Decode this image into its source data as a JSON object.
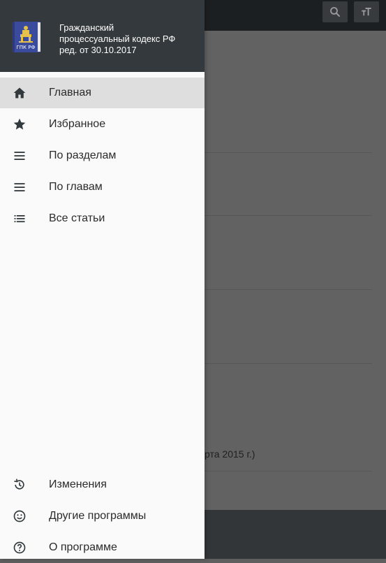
{
  "header": {
    "title_line1": "Гражданский",
    "title_line2": "процессуальный кодекс РФ",
    "title_line3": "ред. от 30.10.2017",
    "logo_text": "ГПК РФ"
  },
  "menu": {
    "items": [
      {
        "label": "Главная",
        "icon": "home-icon",
        "active": true
      },
      {
        "label": "Избранное",
        "icon": "star-icon",
        "active": false
      },
      {
        "label": "По разделам",
        "icon": "menu-lines-icon",
        "active": false
      },
      {
        "label": "По главам",
        "icon": "menu-lines-icon",
        "active": false
      },
      {
        "label": "Все статьи",
        "icon": "list-icon",
        "active": false
      }
    ],
    "bottom_items": [
      {
        "label": "Изменения",
        "icon": "history-icon"
      },
      {
        "label": "Другие программы",
        "icon": "smiley-icon"
      },
      {
        "label": "О программе",
        "icon": "help-icon"
      }
    ]
  },
  "background": {
    "partial_text": "рта 2015 г.)"
  },
  "colors": {
    "drawer_header": "#33393d",
    "active_item": "#dedede",
    "app_bar": "#1c1f21"
  }
}
